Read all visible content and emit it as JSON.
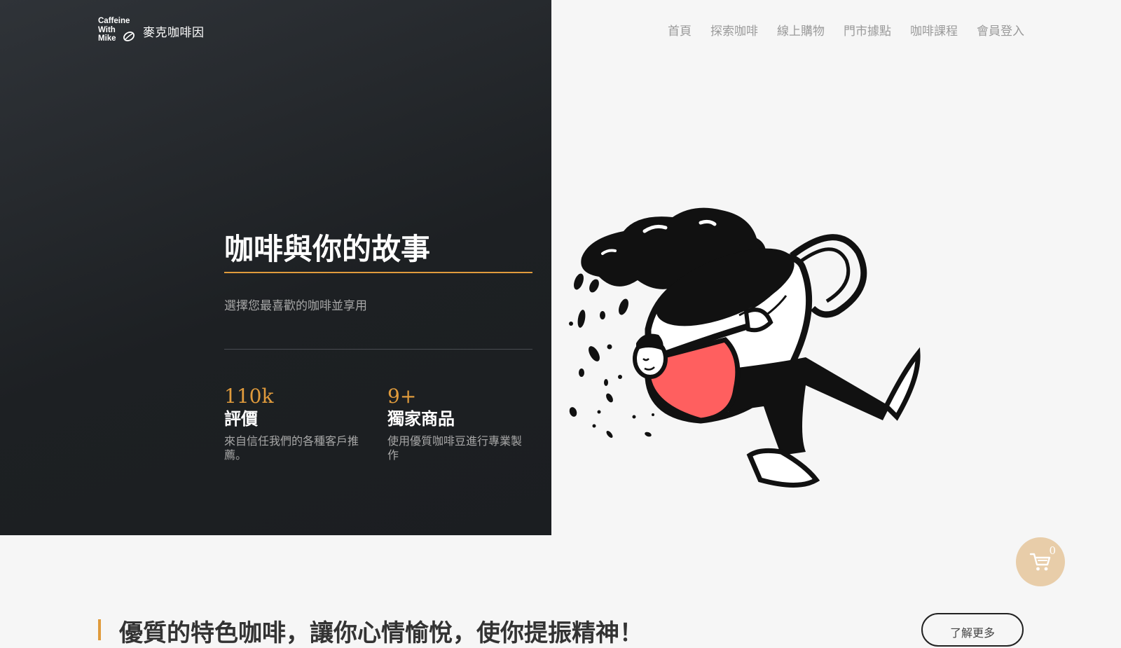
{
  "brand": {
    "logo_lines": [
      "Caffeine",
      "With",
      "Mike"
    ],
    "name": "麥克咖啡因"
  },
  "nav": {
    "items": [
      {
        "label": "首頁"
      },
      {
        "label": "探索咖啡"
      },
      {
        "label": "線上購物"
      },
      {
        "label": "門市據點"
      },
      {
        "label": "咖啡課程"
      },
      {
        "label": "會員登入"
      }
    ]
  },
  "hero": {
    "title": "咖啡與你的故事",
    "subtitle": "選擇您最喜歡的咖啡並享用",
    "stats": [
      {
        "value": "110k",
        "label": "評價",
        "description": "來自信任我們的各種客戶推薦。"
      },
      {
        "value": "9+",
        "label": "獨家商品",
        "description": "使用優質咖啡豆進行專業製作"
      }
    ]
  },
  "cart": {
    "count": "0",
    "icon": "shopping-cart-icon"
  },
  "section": {
    "heading": "優質的特色咖啡，讓你心情愉悅，使你提振精神！",
    "learn_more_label": "了解更多"
  },
  "colors": {
    "accent": "#e09b3c",
    "dark_bg": "#1d2023",
    "light_bg": "#f6f6f6",
    "cart_bg": "#e8cda9",
    "illustration_red": "#ff5f5f"
  }
}
